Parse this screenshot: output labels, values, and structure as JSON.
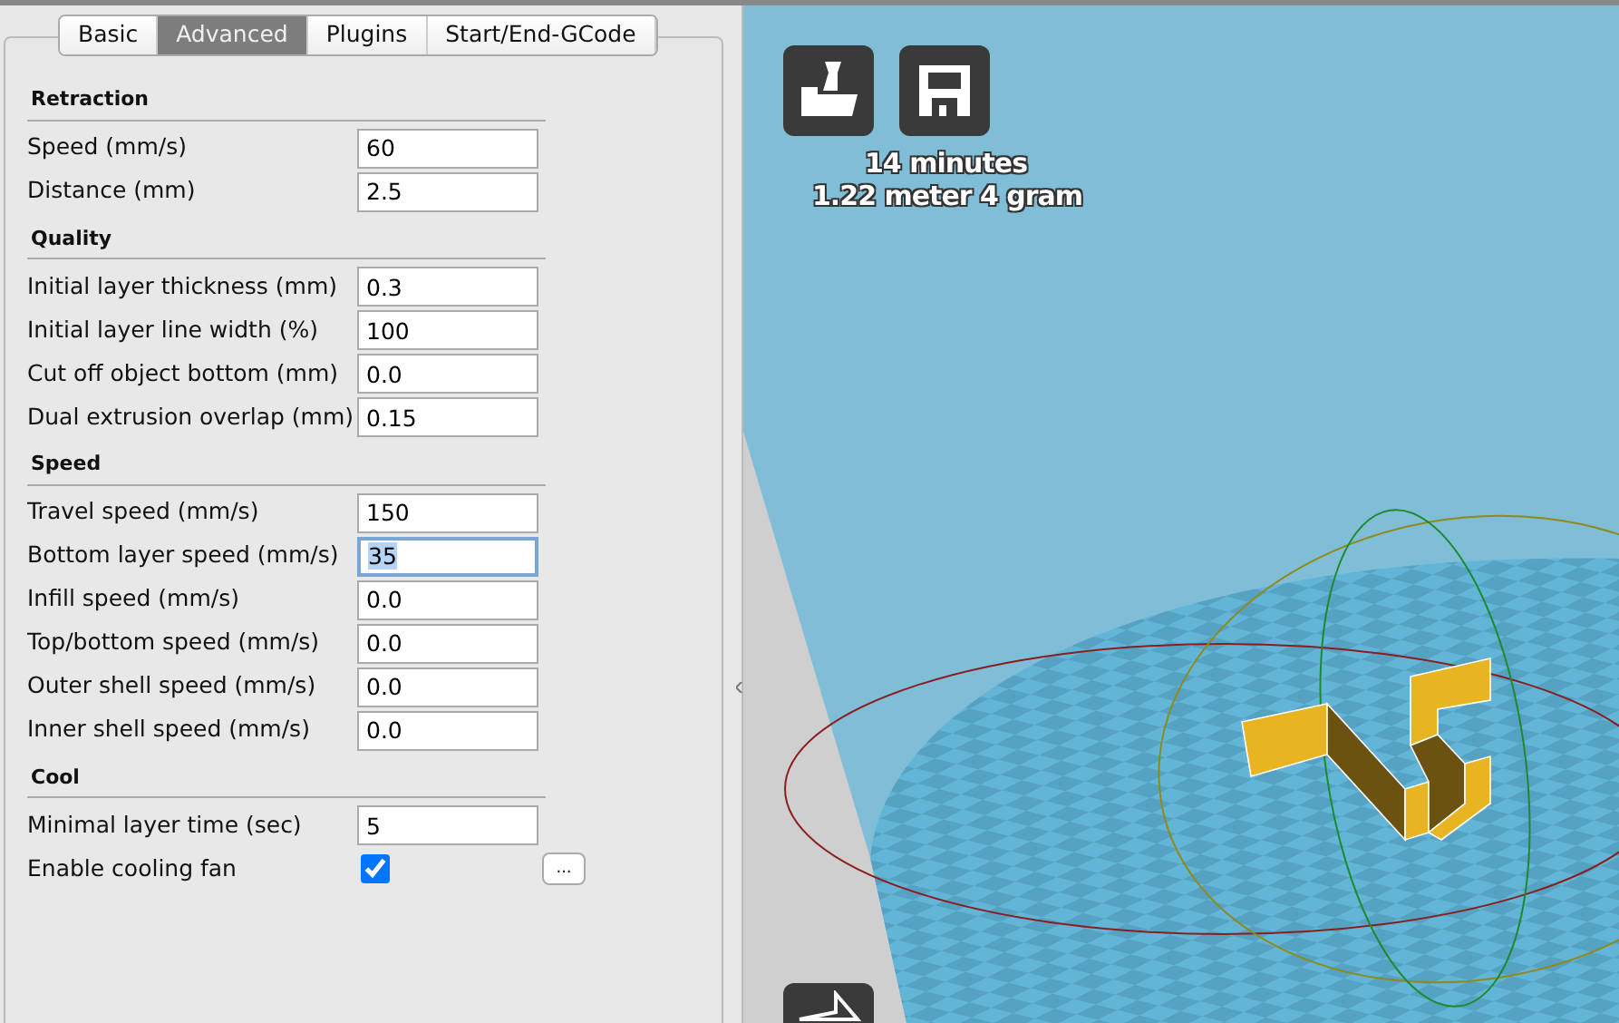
{
  "tabs": [
    {
      "label": "Basic",
      "selected": false
    },
    {
      "label": "Advanced",
      "selected": true
    },
    {
      "label": "Plugins",
      "selected": false
    },
    {
      "label": "Start/End-GCode",
      "selected": false
    }
  ],
  "sections": [
    {
      "title": "Retraction",
      "rows": [
        {
          "kind": "field",
          "label": "Speed (mm/s)",
          "value": "60",
          "focused": false
        },
        {
          "kind": "field",
          "label": "Distance (mm)",
          "value": "2.5",
          "focused": false
        }
      ]
    },
    {
      "title": "Quality",
      "rows": [
        {
          "kind": "field",
          "label": "Initial layer thickness (mm)",
          "value": "0.3",
          "focused": false
        },
        {
          "kind": "field",
          "label": "Initial layer line width (%)",
          "value": "100",
          "focused": false
        },
        {
          "kind": "field",
          "label": "Cut off object bottom (mm)",
          "value": "0.0",
          "focused": false
        },
        {
          "kind": "field",
          "label": "Dual extrusion overlap (mm)",
          "value": "0.15",
          "focused": false
        }
      ]
    },
    {
      "title": "Speed",
      "rows": [
        {
          "kind": "field",
          "label": "Travel speed (mm/s)",
          "value": "150",
          "focused": false
        },
        {
          "kind": "field",
          "label": "Bottom layer speed (mm/s)",
          "value": "35",
          "focused": true
        },
        {
          "kind": "field",
          "label": "Infill speed (mm/s)",
          "value": "0.0",
          "focused": false
        },
        {
          "kind": "field",
          "label": "Top/bottom speed (mm/s)",
          "value": "0.0",
          "focused": false
        },
        {
          "kind": "field",
          "label": "Outer shell speed (mm/s)",
          "value": "0.0",
          "focused": false
        },
        {
          "kind": "field",
          "label": "Inner shell speed (mm/s)",
          "value": "0.0",
          "focused": false
        }
      ]
    },
    {
      "title": "Cool",
      "rows": [
        {
          "kind": "field",
          "label": "Minimal layer time (sec)",
          "value": "5",
          "focused": false
        },
        {
          "kind": "checkbox",
          "label": "Enable cooling fan",
          "checked": true,
          "button": "..."
        }
      ]
    }
  ],
  "viewport": {
    "print_time": "14 minutes",
    "material": "1.22 meter 4 gram"
  }
}
